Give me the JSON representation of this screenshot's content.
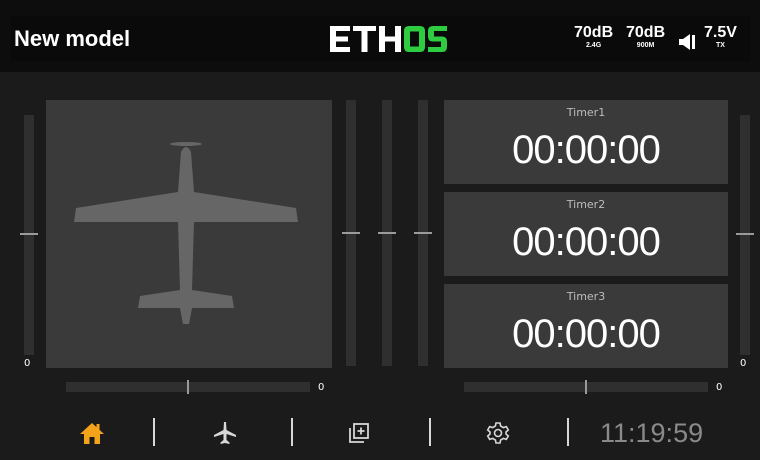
{
  "header": {
    "model_name": "New model",
    "logo_text": "ETHOS",
    "rssi_24": {
      "value": "70dB",
      "band": "2.4G"
    },
    "rssi_900": {
      "value": "70dB",
      "band": "900M"
    },
    "tx_voltage": {
      "value": "7.5V",
      "label": "TX"
    }
  },
  "trims": {
    "left_vertical_value": "0",
    "left_horizontal_value": "0",
    "right_horizontal_value": "0",
    "right_vertical_value": "0"
  },
  "timers": [
    {
      "label": "Timer1",
      "value": "00:00:00"
    },
    {
      "label": "Timer2",
      "value": "00:00:00"
    },
    {
      "label": "Timer3",
      "value": "00:00:00"
    }
  ],
  "nav": {
    "items": [
      "home-icon",
      "airplane-icon",
      "widgets-icon",
      "settings-gear-icon"
    ],
    "clock": "11:19:59"
  },
  "colors": {
    "accent": "#f5a31a",
    "logo_green": "#2ecc40",
    "panel": "#3a3a3a",
    "background": "#1b1b1b"
  }
}
